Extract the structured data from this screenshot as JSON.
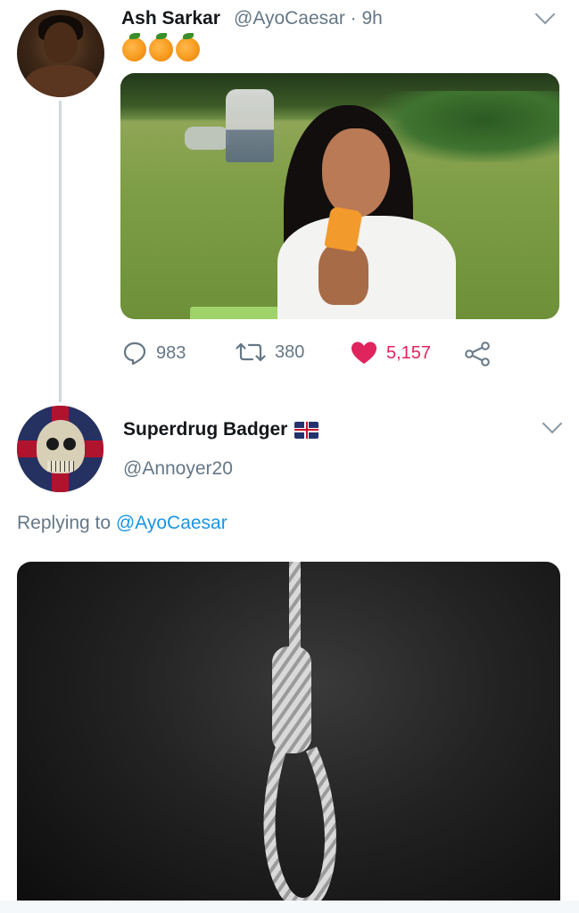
{
  "tweet1": {
    "author_name": "Ash Sarkar",
    "author_handle": "@AyoCaesar",
    "time_meta": "@AyoCaesar · 9h",
    "emoji_text": "🍊🍊🍊",
    "image_alt": "photo",
    "stats": {
      "replies": "983",
      "retweets": "380",
      "likes": "5,157"
    },
    "colors": {
      "like": "#e0245e",
      "muted": "#657786"
    }
  },
  "tweet2": {
    "author_name": "Superdrug Badger",
    "author_handle": "@Annoyer20",
    "replying_prefix": "Replying to",
    "replying_to": "@AyoCaesar"
  },
  "icons": [
    "reply-icon",
    "retweet-icon",
    "heart-icon",
    "share-icon",
    "chevron-down-icon",
    "uk-flag-icon"
  ],
  "colors": {
    "link": "#1b95e0",
    "text": "#14171a",
    "thread_line": "#cfd9de"
  }
}
